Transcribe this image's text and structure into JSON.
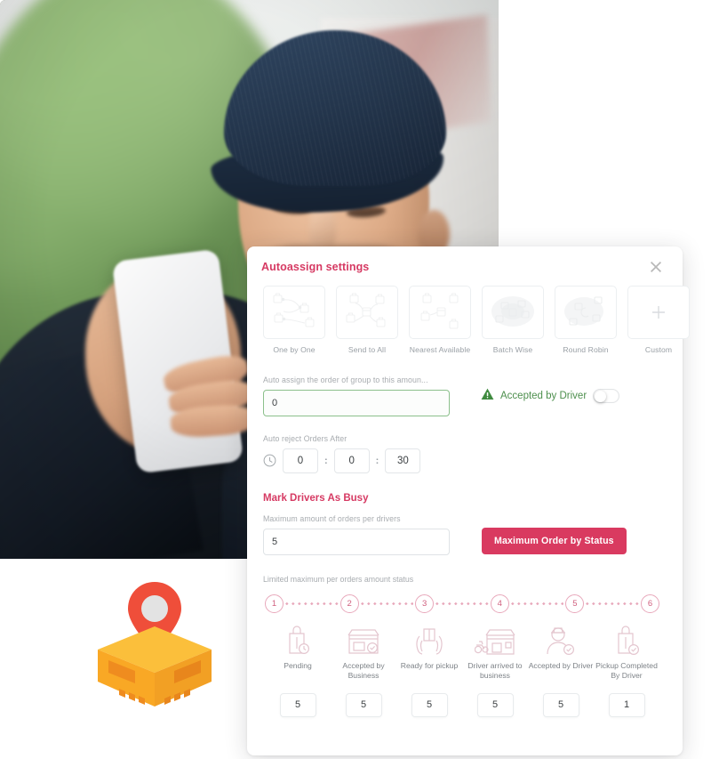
{
  "photo": {
    "alt": "delivery courier in navy cap looking at smartphone holding cardboard boxes"
  },
  "illustration": {
    "name": "package-with-location-pin",
    "box_color": "#f9a825",
    "box_color_light": "#fbbf3b",
    "box_color_dark": "#ef8c1f",
    "pin_color": "#ef4e3a"
  },
  "modal": {
    "title": "Autoassign settings",
    "accent_color": "#d63a63",
    "close_icon": "close-icon",
    "methods": [
      {
        "label": "One by One",
        "icon": "one-by-one-icon",
        "selected": true
      },
      {
        "label": "Send to All",
        "icon": "send-to-all-icon",
        "selected": false
      },
      {
        "label": "Nearest Available",
        "icon": "nearest-available-icon",
        "selected": false
      },
      {
        "label": "Batch Wise",
        "icon": "batch-wise-icon",
        "selected": false
      },
      {
        "label": "Round Robin",
        "icon": "round-robin-icon",
        "selected": false
      },
      {
        "label": "Custom",
        "icon": "plus-icon",
        "selected": false
      }
    ],
    "auto_assign": {
      "label": "Auto assign the order of group to this amoun...",
      "value": "0",
      "placeholder": "0",
      "border_color": "#8cc08c"
    },
    "driver_flag": {
      "icon": "warning-triangle-icon",
      "label": "Accepted by Driver",
      "color": "#4d8f4d",
      "toggle_state": "off"
    },
    "auto_reject": {
      "label": "Auto reject Orders After",
      "icon": "clock-icon",
      "hours": "0",
      "minutes": "0",
      "seconds": "30",
      "separator": ":"
    },
    "mark_busy": {
      "title": "Mark Drivers As Busy",
      "max_orders_label": "Maximum amount of orders per drivers",
      "max_orders_value": "5",
      "button_label": "Maximum Order by Status",
      "button_color": "#d93a60"
    },
    "limited_label": "Limited maximum per orders amount status",
    "stepper": {
      "circle_color": "#e8a8bb",
      "number_color": "#d0607f",
      "steps": [
        {
          "number": "1",
          "name": "Pending",
          "icon": "bag-clock-icon",
          "value": "5"
        },
        {
          "number": "2",
          "name": "Accepted by Business",
          "icon": "store-check-icon",
          "value": "5"
        },
        {
          "number": "3",
          "name": "Ready for pickup",
          "icon": "hands-package-icon",
          "value": "5"
        },
        {
          "number": "4",
          "name": "Driver arrived to business",
          "icon": "scooter-store-icon",
          "value": "5"
        },
        {
          "number": "5",
          "name": "Accepted by Driver",
          "icon": "driver-check-icon",
          "value": "5"
        },
        {
          "number": "6",
          "name": "Pickup Completed By Driver",
          "icon": "bag-check-icon",
          "value": "1"
        }
      ]
    }
  }
}
